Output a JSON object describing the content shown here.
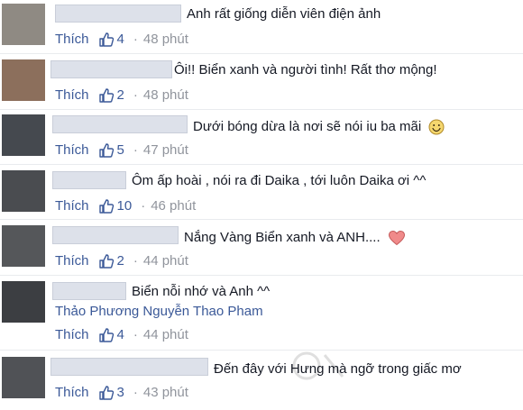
{
  "colors": {
    "link": "#3b5998",
    "meta": "#90949c",
    "text": "#141823",
    "name_placeholder": "#dde1ea"
  },
  "comments": [
    {
      "text": "Anh rất giống diễn viên điện ảnh",
      "like_label": "Thích",
      "likes": "4",
      "time": "48 phút",
      "emoji": null,
      "avatar_color": "#8f8a83"
    },
    {
      "text": "Ôi!! Biển xanh và người tình! Rất thơ mộng!",
      "like_label": "Thích",
      "likes": "2",
      "time": "48 phút",
      "emoji": null,
      "avatar_color": "#8c6f5c"
    },
    {
      "text": "Dưới bóng dừa là nơi sẽ nói iu ba mãi",
      "like_label": "Thích",
      "likes": "5",
      "time": "47 phút",
      "emoji": "smile-icon",
      "avatar_color": "#45494f"
    },
    {
      "text": "Ôm ấp hoài , nói ra đi Daika , tới luôn Daika ơi ^^",
      "like_label": "Thích",
      "likes": "10",
      "time": "46 phút",
      "emoji": null,
      "avatar_color": "#4a4c50"
    },
    {
      "text": "Nắng Vàng Biển xanh và ANH....",
      "like_label": "Thích",
      "likes": "2",
      "time": "44 phút",
      "emoji": "heart-icon",
      "avatar_color": "#55575a"
    },
    {
      "text": "Biển nỗi nhớ và Anh ^^",
      "tags": "Thảo Phương Nguyễn Thao Pham",
      "like_label": "Thích",
      "likes": "4",
      "time": "44 phút",
      "emoji": null,
      "avatar_color": "#3c3e42"
    },
    {
      "text": "Đến đây với Hưng mà ngỡ trong giấc mơ",
      "like_label": "Thích",
      "likes": "3",
      "time": "43 phút",
      "emoji": null,
      "avatar_color": "#505256"
    }
  ],
  "separator": "·"
}
